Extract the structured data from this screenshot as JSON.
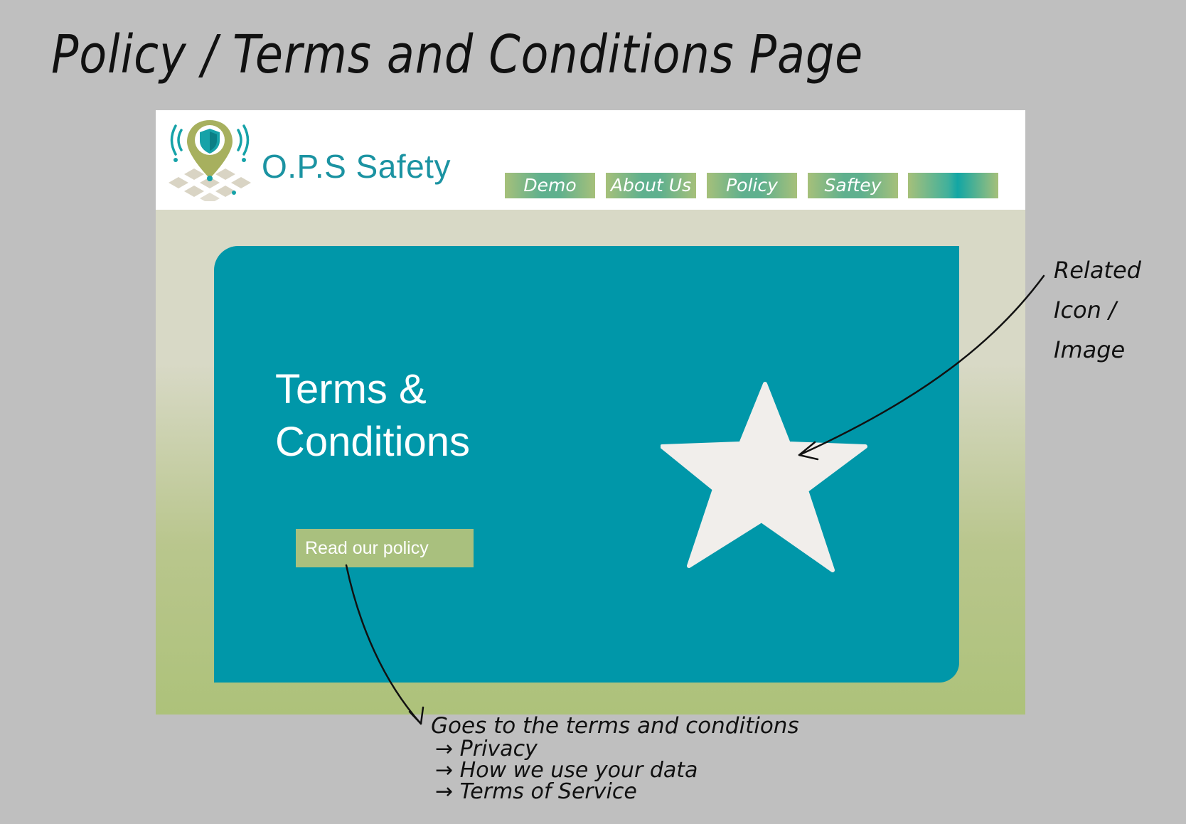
{
  "annotations": {
    "page_title": "Policy / Terms and Conditions Page",
    "related_line1": "Related",
    "related_line2": "Icon / Image",
    "goes_to": "Goes to the terms and conditions",
    "goes_items": [
      "→ Privacy",
      "→ How we use your data",
      "→ Terms of Service"
    ]
  },
  "site": {
    "brand": "O.P.S Safety",
    "logo_icon": "map-pin-shield-icon",
    "nav": [
      "Demo",
      "About Us",
      "Policy",
      "Saftey",
      ""
    ]
  },
  "hero": {
    "title_line1": "Terms &",
    "title_line2": "Conditions",
    "button_label": "Read our policy",
    "image_icon": "star-icon"
  },
  "colors": {
    "background": "#bfbfbf",
    "brand_teal": "#1b93a2",
    "hero_teal": "#0097a9",
    "button_green": "#a9c07e",
    "star": "#f1eeeb"
  }
}
